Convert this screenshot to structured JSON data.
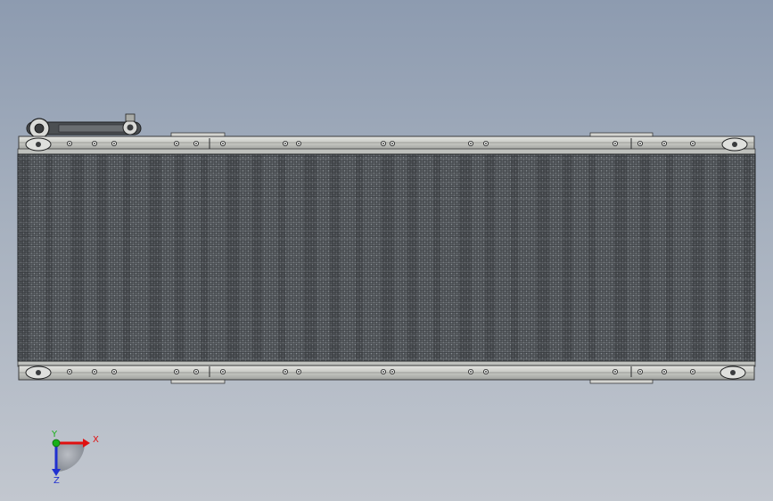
{
  "viewport": {
    "background_top": "#8d9bb0",
    "background_bottom": "#c2c7cf"
  },
  "model": {
    "name": "belt-conveyor",
    "view": "top",
    "frame_color": "#c6c8c5",
    "belt_color": "#5b5f62",
    "mesh_color": "#2b2e31"
  },
  "triad": {
    "x_label": "X",
    "y_label": "Y",
    "z_label": "Z",
    "x_color": "#e01010",
    "y_color": "#18b018",
    "z_color": "#2030d0"
  }
}
